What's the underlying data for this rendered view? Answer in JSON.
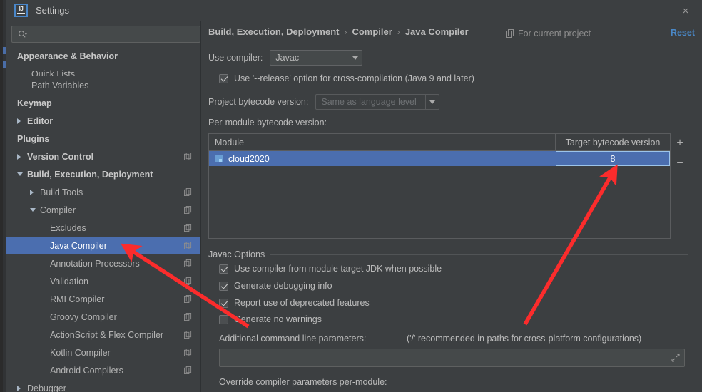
{
  "window": {
    "title": "Settings",
    "logo_text": "IJ",
    "close_icon": "×"
  },
  "sidebar": {
    "search_placeholder": "",
    "search_value": "",
    "items": [
      {
        "label": "Appearance & Behavior",
        "indent": 16,
        "bold": true,
        "arrow": "",
        "copy": false,
        "selected": false,
        "clipped": false
      },
      {
        "label": "Quick Lists",
        "indent": 36,
        "bold": false,
        "arrow": "",
        "copy": false,
        "selected": false,
        "clipped": true
      },
      {
        "label": "Path Variables",
        "indent": 36,
        "bold": false,
        "arrow": "",
        "copy": false,
        "selected": false,
        "clipped": false
      },
      {
        "label": "Keymap",
        "indent": 16,
        "bold": true,
        "arrow": "",
        "copy": false,
        "selected": false,
        "clipped": false
      },
      {
        "label": "Editor",
        "indent": 30,
        "bold": true,
        "arrow": "right",
        "copy": false,
        "selected": false,
        "clipped": false
      },
      {
        "label": "Plugins",
        "indent": 16,
        "bold": true,
        "arrow": "",
        "copy": false,
        "selected": false,
        "clipped": false
      },
      {
        "label": "Version Control",
        "indent": 30,
        "bold": true,
        "arrow": "right",
        "copy": true,
        "selected": false,
        "clipped": false
      },
      {
        "label": "Build, Execution, Deployment",
        "indent": 30,
        "bold": true,
        "arrow": "down",
        "copy": false,
        "selected": false,
        "clipped": false
      },
      {
        "label": "Build Tools",
        "indent": 48,
        "bold": false,
        "arrow": "right",
        "copy": true,
        "selected": false,
        "clipped": false
      },
      {
        "label": "Compiler",
        "indent": 48,
        "bold": false,
        "arrow": "down",
        "copy": true,
        "selected": false,
        "clipped": false
      },
      {
        "label": "Excludes",
        "indent": 62,
        "bold": false,
        "arrow": "",
        "copy": true,
        "selected": false,
        "clipped": false
      },
      {
        "label": "Java Compiler",
        "indent": 62,
        "bold": false,
        "arrow": "",
        "copy": true,
        "selected": true,
        "clipped": false
      },
      {
        "label": "Annotation Processors",
        "indent": 62,
        "bold": false,
        "arrow": "",
        "copy": true,
        "selected": false,
        "clipped": false
      },
      {
        "label": "Validation",
        "indent": 62,
        "bold": false,
        "arrow": "",
        "copy": true,
        "selected": false,
        "clipped": false
      },
      {
        "label": "RMI Compiler",
        "indent": 62,
        "bold": false,
        "arrow": "",
        "copy": true,
        "selected": false,
        "clipped": false
      },
      {
        "label": "Groovy Compiler",
        "indent": 62,
        "bold": false,
        "arrow": "",
        "copy": true,
        "selected": false,
        "clipped": false
      },
      {
        "label": "ActionScript & Flex Compiler",
        "indent": 62,
        "bold": false,
        "arrow": "",
        "copy": true,
        "selected": false,
        "clipped": false
      },
      {
        "label": "Kotlin Compiler",
        "indent": 62,
        "bold": false,
        "arrow": "",
        "copy": true,
        "selected": false,
        "clipped": false
      },
      {
        "label": "Android Compilers",
        "indent": 62,
        "bold": false,
        "arrow": "",
        "copy": true,
        "selected": false,
        "clipped": false
      },
      {
        "label": "Debugger",
        "indent": 30,
        "bold": false,
        "arrow": "right",
        "copy": false,
        "selected": false,
        "clipped": false
      }
    ]
  },
  "panel": {
    "breadcrumb": {
      "part1": "Build, Execution, Deployment",
      "sep1": "›",
      "part2": "Compiler",
      "sep2": "›",
      "part3": "Java Compiler"
    },
    "for_current_project": "For current project",
    "reset_label": "Reset",
    "use_compiler_label": "Use compiler:",
    "use_compiler_value": "Javac",
    "release_option_label": "Use '--release' option for cross-compilation (Java 9 and later)",
    "release_option_checked": true,
    "project_bytecode_label": "Project bytecode version:",
    "project_bytecode_value": "Same as language level",
    "per_module_label": "Per-module bytecode version:",
    "table": {
      "headers": {
        "module": "Module",
        "target": "Target bytecode version"
      },
      "rows": [
        {
          "module": "cloud2020",
          "target": "8",
          "selected": true
        }
      ],
      "add_button": "+",
      "remove_button": "−"
    },
    "javac_options": {
      "group_title": "Javac Options",
      "checkboxes": [
        {
          "label": "Use compiler from module target JDK when possible",
          "checked": true
        },
        {
          "label": "Generate debugging info",
          "checked": true
        },
        {
          "label": "Report use of deprecated features",
          "checked": true
        },
        {
          "label": "Generate no warnings",
          "checked": false
        }
      ],
      "additional_params_label": "Additional command line parameters:",
      "additional_params_hint": "('/' recommended in paths for cross-platform configurations)",
      "additional_params_value": "",
      "override_label": "Override compiler parameters per-module:"
    }
  },
  "annotations": {
    "arrow_color": "#fb2c2c",
    "arrow1_target": "Java Compiler sidebar item",
    "arrow2_target": "Target bytecode version cell value 8"
  },
  "colors": {
    "accent_selection": "#4b6eaf",
    "link": "#4a88c7",
    "panel_bg": "#3c3f41",
    "field_bg": "#45494a",
    "annotation_red": "#fb2c2c"
  }
}
